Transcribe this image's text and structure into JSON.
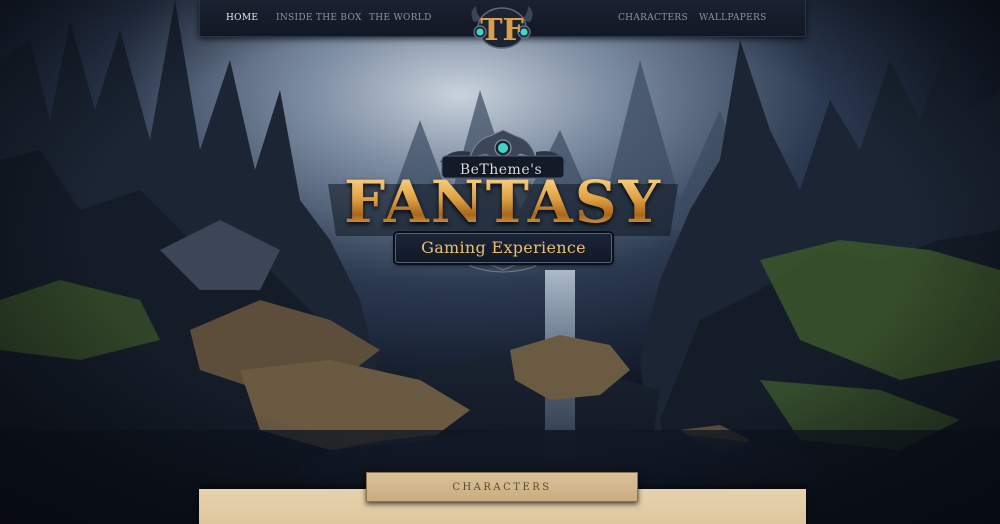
{
  "nav": {
    "left_items": [
      {
        "label": "HOME",
        "active": true
      },
      {
        "label": "INSIDE THE BOX",
        "active": false
      },
      {
        "label": "THE WORLD",
        "active": false
      }
    ],
    "right_items": [
      {
        "label": "CHARACTERS",
        "active": false
      },
      {
        "label": "WALLPAPERS",
        "active": false
      }
    ],
    "logo_icon": "tf-monogram-emblem"
  },
  "hero": {
    "brand": "BeTheme's",
    "title": "FANTASY",
    "tagline": "Gaming Experience"
  },
  "section": {
    "heading": "CHARACTERS"
  },
  "colors": {
    "gold": "#e0a84a",
    "gem": "#3fd6c6",
    "nav_bg": "#161d2a",
    "parchment": "#e2cba3"
  }
}
